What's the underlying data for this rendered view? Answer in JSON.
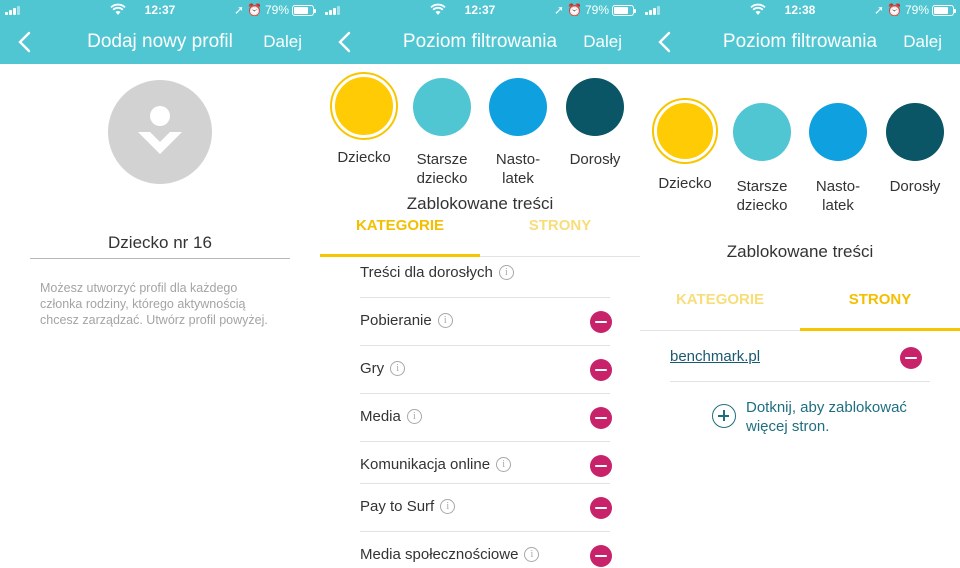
{
  "colors": {
    "header": "#4fc6d2",
    "level_child": "#ffcb05",
    "level_older_child": "#4fc6d2",
    "level_teen": "#0fa0e0",
    "level_adult": "#0a5566",
    "remove": "#c8226a",
    "tab_active": "#f4bf00"
  },
  "status_bars": [
    {
      "time": "12:37",
      "battery": "79%"
    },
    {
      "time": "12:37",
      "battery": "79%"
    },
    {
      "time": "12:38",
      "battery": "79%"
    }
  ],
  "screen1": {
    "nav": {
      "title": "Dodaj nowy profil",
      "next": "Dalej"
    },
    "avatar_icon": "person-heart-icon",
    "profile_name": "Dziecko nr 16",
    "hint": "Możesz utworzyć profil dla każdego członka rodziny, którego aktywnością chcesz zarządzać. Utwórz profil powyżej."
  },
  "screen2": {
    "nav": {
      "title": "Poziom filtrowania",
      "next": "Dalej"
    },
    "levels": [
      {
        "label": "Dziecko",
        "selected": true
      },
      {
        "label": "Starsze dziecko",
        "selected": false
      },
      {
        "label": "Nasto-latek",
        "selected": false
      },
      {
        "label": "Dorosły",
        "selected": false
      }
    ],
    "blocked_title": "Zablokowane treści",
    "tabs": [
      {
        "label": "KATEGORIE",
        "active": true
      },
      {
        "label": "STRONY",
        "active": false
      }
    ],
    "categories": [
      {
        "name": "Treści dla dorosłych",
        "info": "i",
        "blocked": false
      },
      {
        "name": "Pobieranie",
        "info": "i",
        "blocked": true
      },
      {
        "name": "Gry",
        "info": "i",
        "blocked": true
      },
      {
        "name": "Media",
        "info": "i",
        "blocked": true
      },
      {
        "name": "Komunikacja online",
        "info": "i",
        "blocked": true
      },
      {
        "name": "Pay to Surf",
        "info": "i",
        "blocked": true
      },
      {
        "name": "Media społecznościowe",
        "info": "i",
        "blocked": true
      }
    ]
  },
  "screen3": {
    "nav": {
      "title": "Poziom filtrowania",
      "next": "Dalej"
    },
    "levels": [
      {
        "label": "Dziecko",
        "selected": true
      },
      {
        "label": "Starsze dziecko",
        "selected": false
      },
      {
        "label": "Nasto-latek",
        "selected": false
      },
      {
        "label": "Dorosły",
        "selected": false
      }
    ],
    "blocked_title": "Zablokowane treści",
    "tabs": [
      {
        "label": "KATEGORIE",
        "active": false
      },
      {
        "label": "STRONY",
        "active": true
      }
    ],
    "sites": [
      {
        "url": "benchmark.pl"
      }
    ],
    "add_site": "Dotknij, aby zablokować więcej stron."
  }
}
